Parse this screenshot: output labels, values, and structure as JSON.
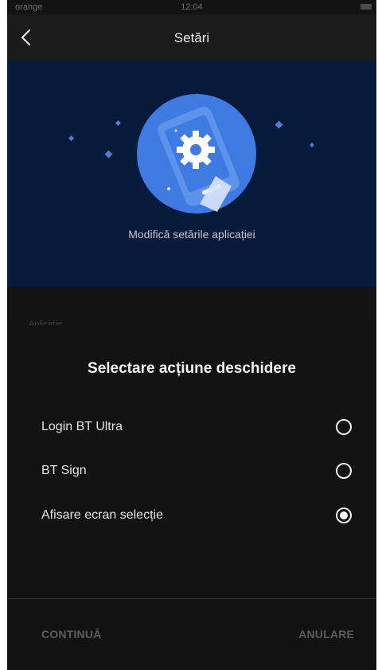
{
  "status_bar": {
    "carrier": "orange",
    "time": "12:04"
  },
  "nav": {
    "title": "Setări"
  },
  "hero": {
    "caption": "Modifică setările aplicației"
  },
  "section": {
    "peek_label": "Aplicatie"
  },
  "sheet": {
    "title": "Selectare acțiune deschidere",
    "options": [
      {
        "label": "Login BT Ultra",
        "selected": false
      },
      {
        "label": "BT Sign",
        "selected": false
      },
      {
        "label": "Afisare ecran selecție",
        "selected": true
      }
    ],
    "continue_label": "CONTINUĂ",
    "cancel_label": "ANULARE"
  },
  "colors": {
    "hero_bg": "#061a3c",
    "circle": "#3d7be3",
    "sheet_bg": "#121212",
    "disabled_text": "#5c5c5c"
  }
}
